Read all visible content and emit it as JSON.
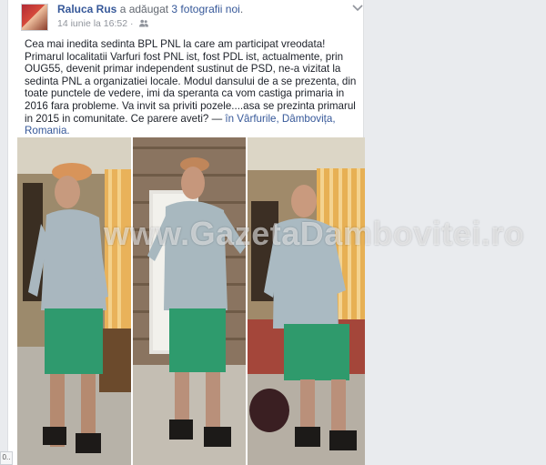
{
  "post": {
    "author": "Raluca Rus",
    "action_text": " a adăugat ",
    "photos_link": "3 fotografii noi",
    "action_suffix": ".",
    "timestamp": "14 iunie la 16:52",
    "separator": " · ",
    "body_text": "Cea mai inedita sedinta BPL PNL la care am participat vreodata! Primarul localitatii Varfuri fost PNL ist, fost PDL ist, actualmente, prin OUG55, devenit primar independent sustinut de PSD, ne-a vizitat la sedinta PNL a organizatiei locale. Modul dansului de a se prezenta, din toate punctele de vedere, imi da speranta ca vom castiga primaria in 2016 fara probleme. Va invit sa priviti pozele....asa se prezinta primarul in 2015 in comunitate. Ce parere aveti? — ",
    "location_text": "în Vârfurile, Dâmbovița, Romania.",
    "icons": {
      "audience": "friends-audience-icon",
      "options": "chevron-down-icon"
    }
  },
  "watermark": "www.GazetaDambovitei.ro",
  "status_bubble": "0..",
  "colors": {
    "link": "#365899",
    "text": "#1d2129",
    "meta": "#90949c",
    "background": "#e9ebee"
  }
}
